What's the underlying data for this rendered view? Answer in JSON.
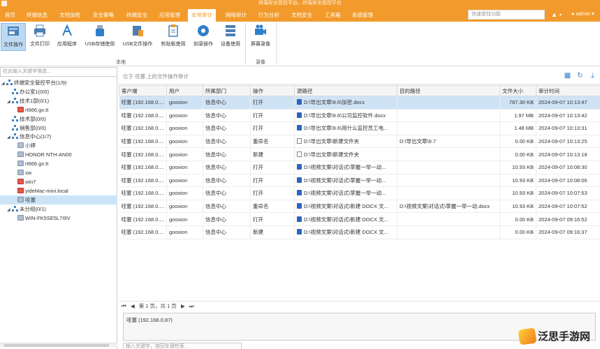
{
  "window": {
    "title": "终端安全管控平台，终端安全管控平台"
  },
  "menu": {
    "items": [
      "首页",
      "终端信息",
      "文档加密",
      "安全策略",
      "终端安全",
      "应用管理",
      "本地审计",
      "网络审计",
      "行为分析",
      "文档安全",
      "工具箱",
      "系统管理"
    ],
    "active_index": 6,
    "search_placeholder": "快速查找功能",
    "user": "admin"
  },
  "ribbon": {
    "buttons": [
      {
        "label": "文件操作",
        "icon": "file-operation-icon"
      },
      {
        "label": "文件打印",
        "icon": "printer-icon"
      },
      {
        "label": "应用程序",
        "icon": "app-icon"
      },
      {
        "label": "USB存储使用",
        "icon": "usb-icon"
      },
      {
        "label": "USB文件操作",
        "icon": "usb-file-icon"
      },
      {
        "label": "剪贴板使用",
        "icon": "clipboard-icon"
      },
      {
        "label": "刻录操作",
        "icon": "disc-icon"
      },
      {
        "label": "设备使用",
        "icon": "device-icon"
      },
      {
        "label": "屏幕录像",
        "icon": "camera-icon"
      }
    ],
    "group_local": "本地",
    "group_record": "录像"
  },
  "tree": {
    "filter_placeholder": "在此输入关键字筛选...",
    "nodes": [
      {
        "label": "终端安全管控平台(1/9)",
        "level": 0,
        "kind": "org",
        "toggle": "◢"
      },
      {
        "label": "办公室1(0/0)",
        "level": 1,
        "kind": "org",
        "toggle": ""
      },
      {
        "label": "技术1部(0/1)",
        "level": 1,
        "kind": "org",
        "toggle": "◢"
      },
      {
        "label": "rt666.gx.tt",
        "level": 2,
        "kind": "pc-red",
        "toggle": ""
      },
      {
        "label": "技术部(0/0)",
        "level": 1,
        "kind": "org",
        "toggle": ""
      },
      {
        "label": "销售部(0/0)",
        "level": 1,
        "kind": "org",
        "toggle": ""
      },
      {
        "label": "信息中心(1/7)",
        "level": 1,
        "kind": "org",
        "toggle": "◢"
      },
      {
        "label": "小婷",
        "level": 2,
        "kind": "pc",
        "toggle": ""
      },
      {
        "label": "HONOR NTH-AN00",
        "level": 2,
        "kind": "pc",
        "toggle": ""
      },
      {
        "label": "rt666.gx.tt",
        "level": 2,
        "kind": "pc",
        "toggle": ""
      },
      {
        "label": "sw",
        "level": 2,
        "kind": "pc",
        "toggle": ""
      },
      {
        "label": "win7",
        "level": 2,
        "kind": "pc-red",
        "toggle": ""
      },
      {
        "label": "yideMac-mini.local",
        "level": 2,
        "kind": "pc-red",
        "toggle": ""
      },
      {
        "label": "哇塞",
        "level": 2,
        "kind": "pc",
        "toggle": "",
        "selected": true
      },
      {
        "label": "未分组(0/1)",
        "level": 1,
        "kind": "org",
        "toggle": "◢"
      },
      {
        "label": "WIN-FK5SE5L7I9V",
        "level": 2,
        "kind": "pc",
        "toggle": ""
      }
    ]
  },
  "breadcrumb": "位于 哇塞 上的文件操作审计",
  "table": {
    "columns": [
      "客户端",
      "用户",
      "所属部门",
      "操作",
      "源路径",
      "目的路径",
      "文件大小",
      "审计时间"
    ],
    "rows": [
      {
        "client": "哇塞 (192.168.0....",
        "user": "gooxion",
        "dept": "信息中心",
        "op": "打开",
        "icon": "docx",
        "src": "D:\\导出文章\\9.6\\加密.docx",
        "dst": "",
        "size": "787.30 KB",
        "time": "2024-09-07 10:13:47",
        "selected": true
      },
      {
        "client": "哇塞 (192.168.0....",
        "user": "gooxion",
        "dept": "信息中心",
        "op": "打开",
        "icon": "docx",
        "src": "D:\\导出文章\\9.6\\公司监控软件.docx",
        "dst": "",
        "size": "1.97 MB",
        "time": "2024-09-07 10:13:42"
      },
      {
        "client": "哇塞 (192.168.0....",
        "user": "gooxion",
        "dept": "信息中心",
        "op": "打开",
        "icon": "docx",
        "src": "D:\\导出文章\\9.6\\用什么监控员工电...",
        "dst": "",
        "size": "1.48 MB",
        "time": "2024-09-07 10:13:31"
      },
      {
        "client": "哇塞 (192.168.0....",
        "user": "gooxion",
        "dept": "信息中心",
        "op": "重命名",
        "icon": "folder",
        "src": "D:\\导出文章\\新建文件夹",
        "dst": "D:\\导出文章\\9.7",
        "size": "0.00 KB",
        "time": "2024-09-07 10:13:25"
      },
      {
        "client": "哇塞 (192.168.0....",
        "user": "gooxion",
        "dept": "信息中心",
        "op": "新建",
        "icon": "folder",
        "src": "D:\\导出文章\\新建文件夹",
        "dst": "",
        "size": "0.00 KB",
        "time": "2024-09-07 10:13:18"
      },
      {
        "client": "哇塞 (192.168.0....",
        "user": "gooxion",
        "dept": "信息中心",
        "op": "打开",
        "icon": "docx",
        "src": "D:\\视频文案\\对话式\\掌握一举一动...",
        "dst": "",
        "size": "10.93 KB",
        "time": "2024-09-07 10:08:30"
      },
      {
        "client": "哇塞 (192.168.0....",
        "user": "gooxion",
        "dept": "信息中心",
        "op": "打开",
        "icon": "docx",
        "src": "D:\\视频文案\\对话式\\掌握一举一动...",
        "dst": "",
        "size": "10.93 KB",
        "time": "2024-09-07 10:08:06"
      },
      {
        "client": "哇塞 (192.168.0....",
        "user": "gooxion",
        "dept": "信息中心",
        "op": "打开",
        "icon": "docx",
        "src": "D:\\视频文案\\对话式\\掌握一举一动...",
        "dst": "",
        "size": "10.93 KB",
        "time": "2024-09-07 10:07:53"
      },
      {
        "client": "哇塞 (192.168.0....",
        "user": "gooxion",
        "dept": "信息中心",
        "op": "重命名",
        "icon": "docx",
        "src": "D:\\视频文案\\对话式\\新建 DOCX 文...",
        "dst": "D:\\视频文案\\对话式\\掌握一举一动.docx",
        "size": "10.93 KB",
        "time": "2024-09-07 10:07:52"
      },
      {
        "client": "哇塞 (192.168.0....",
        "user": "gooxion",
        "dept": "信息中心",
        "op": "打开",
        "icon": "docx",
        "src": "D:\\视频文案\\对话式\\新建 DOCX 文...",
        "dst": "",
        "size": "0.00 KB",
        "time": "2024-09-07 09:16:52"
      },
      {
        "client": "哇塞 (192.168.0....",
        "user": "gooxion",
        "dept": "信息中心",
        "op": "新建",
        "icon": "docx",
        "src": "D:\\视频文案\\对话式\\新建 DOCX 文...",
        "dst": "",
        "size": "0.00 KB",
        "time": "2024-09-07 09:16:37"
      }
    ]
  },
  "pager": {
    "text": "第 1 页，共 1 页"
  },
  "detail": {
    "text": "哇塞 (192.168.0.87)"
  },
  "bottom_search": {
    "placeholder": "输入关键字，按回车键检索..."
  },
  "watermark": {
    "text": "泛思手游网"
  },
  "colors": {
    "accent": "#f29b2c",
    "selected_row": "#cfe3f6",
    "ribbon_active": "#bcd9f3"
  }
}
